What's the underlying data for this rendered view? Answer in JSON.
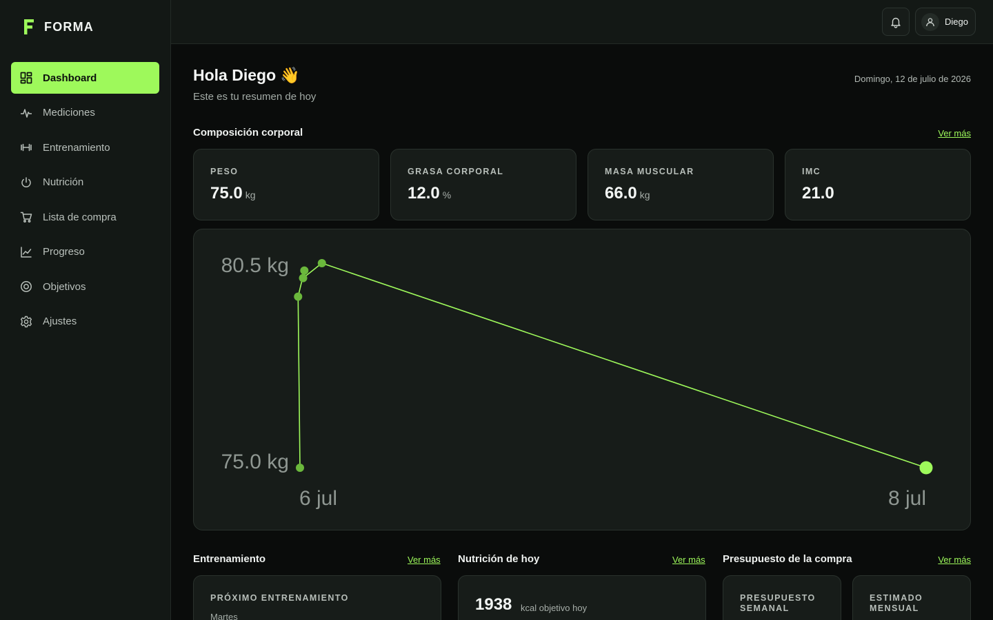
{
  "brand": {
    "name": "FORMA",
    "accent": "#9ef95b"
  },
  "sidebar": {
    "items": [
      {
        "label": "Dashboard",
        "icon": "grid-icon",
        "active": true
      },
      {
        "label": "Mediciones",
        "icon": "pulse-icon"
      },
      {
        "label": "Entrenamiento",
        "icon": "dumbbell-icon"
      },
      {
        "label": "Nutrición",
        "icon": "power-icon"
      },
      {
        "label": "Lista de compra",
        "icon": "cart-icon"
      },
      {
        "label": "Progreso",
        "icon": "chart-line-icon"
      },
      {
        "label": "Objetivos",
        "icon": "target-icon"
      },
      {
        "label": "Ajustes",
        "icon": "gear-icon"
      }
    ]
  },
  "topbar": {
    "user_name": "Diego"
  },
  "header": {
    "greeting": "Hola Diego",
    "greeting_emoji": "👋",
    "subtitle": "Este es tu resumen de hoy",
    "date": "Domingo, 12 de julio de 2026"
  },
  "composition": {
    "title": "Composición corporal",
    "link": "Ver más",
    "cards": [
      {
        "label": "PESO",
        "value": "75.0",
        "unit": "kg"
      },
      {
        "label": "GRASA CORPORAL",
        "value": "12.0",
        "unit": "%"
      },
      {
        "label": "MASA MUSCULAR",
        "value": "66.0",
        "unit": "kg"
      },
      {
        "label": "IMC",
        "value": "21.0",
        "unit": ""
      }
    ]
  },
  "chart_data": {
    "type": "line",
    "y_tick_labels": [
      "80.5 kg",
      "75.0 kg"
    ],
    "x_tick_labels": [
      "6 jul",
      "8 jul"
    ],
    "ylim": [
      75.0,
      80.5
    ],
    "series": [
      {
        "color": "#9ef95b",
        "points": [
          {
            "x": 0.0,
            "y": 75.0
          },
          {
            "x": -0.03,
            "y": 79.6
          },
          {
            "x": 0.07,
            "y": 80.3
          },
          {
            "x": 0.05,
            "y": 80.1
          },
          {
            "x": 0.35,
            "y": 80.5
          },
          {
            "x": 10.0,
            "y": 75.0
          }
        ]
      }
    ]
  },
  "training": {
    "title": "Entrenamiento",
    "link": "Ver más",
    "card_label": "PRÓXIMO ENTRENAMIENTO",
    "card_sub": "Martes"
  },
  "nutrition": {
    "title": "Nutrición de hoy",
    "link": "Ver más",
    "kcal": "1938",
    "kcal_label": "kcal objetivo hoy"
  },
  "budget": {
    "title": "Presupuesto de la compra",
    "link": "Ver más",
    "weekly_label": "PRESUPUESTO SEMANAL",
    "monthly_label": "ESTIMADO MENSUAL"
  }
}
